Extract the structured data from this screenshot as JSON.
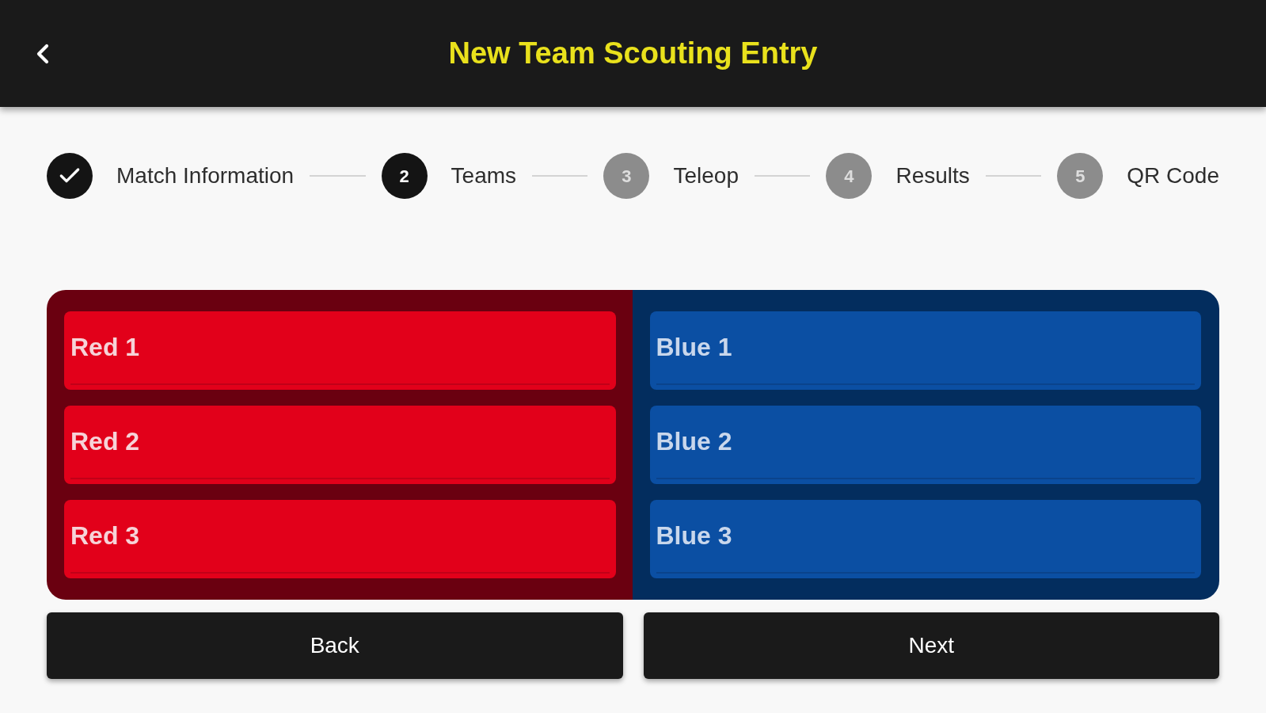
{
  "header": {
    "title": "New Team Scouting Entry"
  },
  "stepper": [
    {
      "label": "Match Information",
      "kind": "completed"
    },
    {
      "number": "2",
      "label": "Teams",
      "kind": "active"
    },
    {
      "number": "3",
      "label": "Teleop",
      "kind": "pending"
    },
    {
      "number": "4",
      "label": "Results",
      "kind": "pending"
    },
    {
      "number": "5",
      "label": "QR Code",
      "kind": "pending"
    }
  ],
  "alliances": [
    {
      "kind": "red",
      "fields": [
        {
          "placeholder": "Red 1"
        },
        {
          "placeholder": "Red 2"
        },
        {
          "placeholder": "Red 3"
        }
      ]
    },
    {
      "kind": "blue",
      "fields": [
        {
          "placeholder": "Blue 1"
        },
        {
          "placeholder": "Blue 2"
        },
        {
          "placeholder": "Blue 3"
        }
      ]
    }
  ],
  "buttons": [
    {
      "label": "Back"
    },
    {
      "label": "Next"
    }
  ]
}
